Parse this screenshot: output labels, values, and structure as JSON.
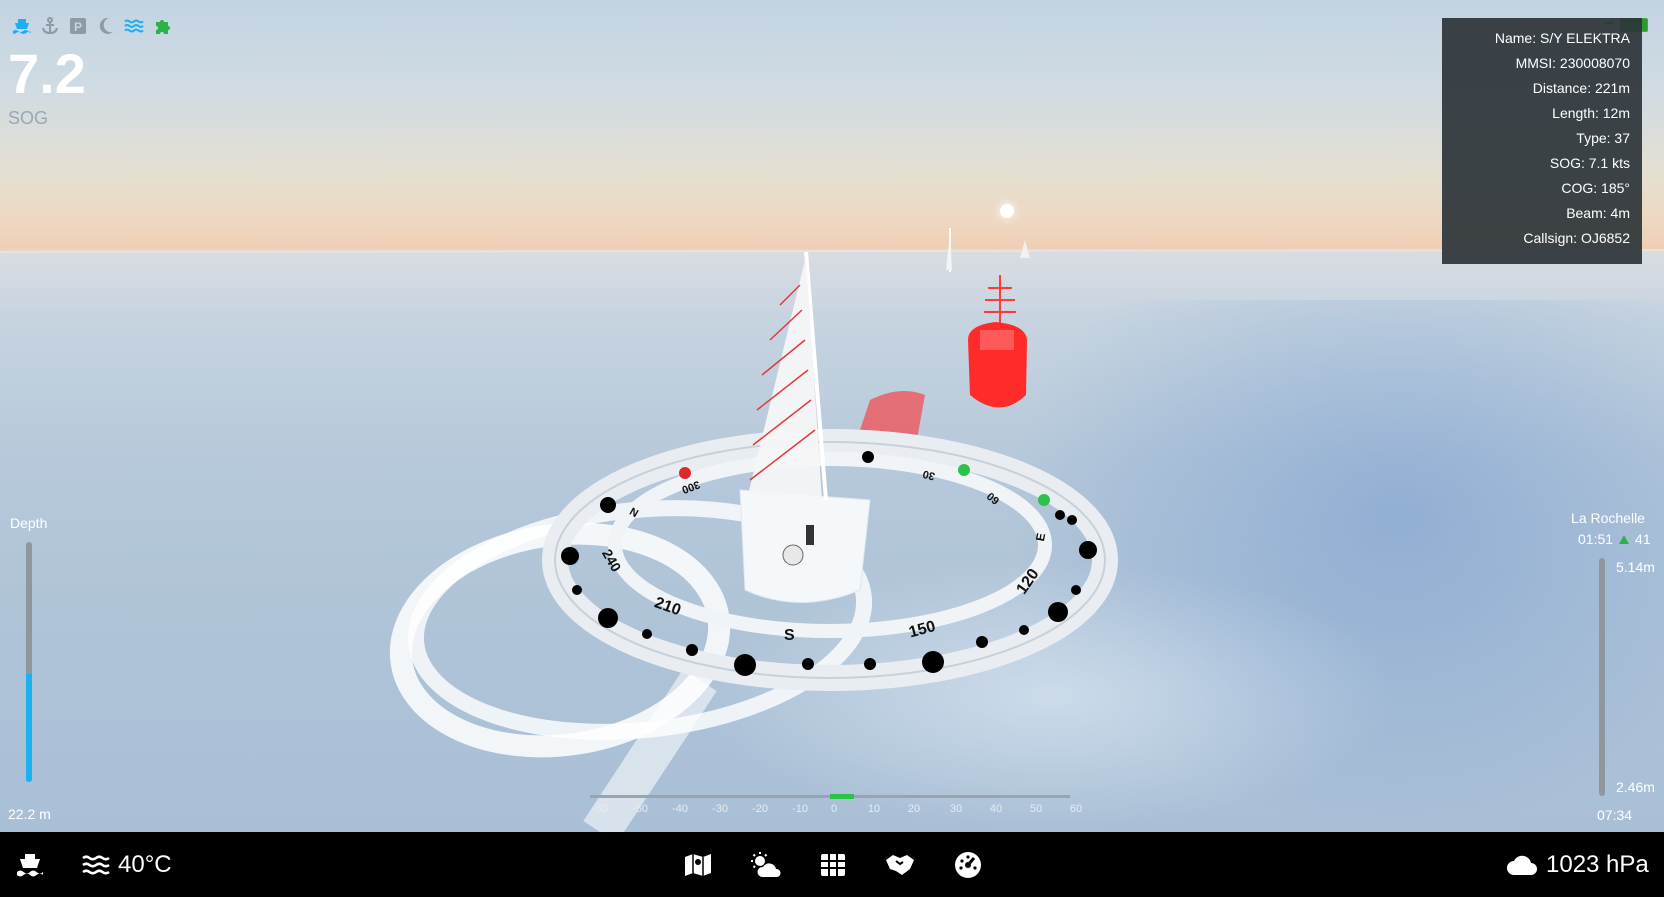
{
  "sog": {
    "value": "7.2",
    "label": "SOG"
  },
  "status_icons": [
    "ship-icon",
    "anchor-icon",
    "parking-icon",
    "moon-icon",
    "waves-icon",
    "puzzle-icon"
  ],
  "colors": {
    "accent": "#1ab1f0",
    "green": "#2bb34a",
    "panel": "#2d343a",
    "target_vessel": "#ff2a2a"
  },
  "ais_panel": {
    "name": "Name: S/Y ELEKTRA",
    "mmsi": "MMSI: 230008070",
    "distance": "Distance: 221m",
    "length": "Length: 12m",
    "type": "Type: 37",
    "sog": "SOG: 7.1 kts",
    "cog": "COG: 185°",
    "beam": "Beam: 4m",
    "callsign": "Callsign: OJ6852"
  },
  "depth": {
    "title": "Depth",
    "value": "22.2 m",
    "fill_fraction": 0.45
  },
  "tide": {
    "place": "La Rochelle",
    "time_now": "01:51",
    "coefficient": "41",
    "high": "5.14m",
    "low": "2.46m",
    "next_time": "07:34"
  },
  "compass": {
    "labels": [
      "300",
      "N",
      "240",
      "210",
      "S",
      "150",
      "120",
      "E",
      "60",
      "30"
    ]
  },
  "scale": {
    "labels": [
      "-60",
      "-50",
      "-40",
      "-30",
      "-20",
      "-10",
      "0",
      "10",
      "20",
      "30",
      "40",
      "50",
      "60"
    ],
    "value": 0
  },
  "bottom_bar": {
    "left_icons": [
      "boat-icon",
      "water-temp-icon"
    ],
    "water_temp": "40°C",
    "center_icons": [
      "map-icon",
      "weather-icon",
      "grid-icon",
      "handshake-icon",
      "gauge-icon"
    ],
    "pressure": "1023 hPa"
  }
}
